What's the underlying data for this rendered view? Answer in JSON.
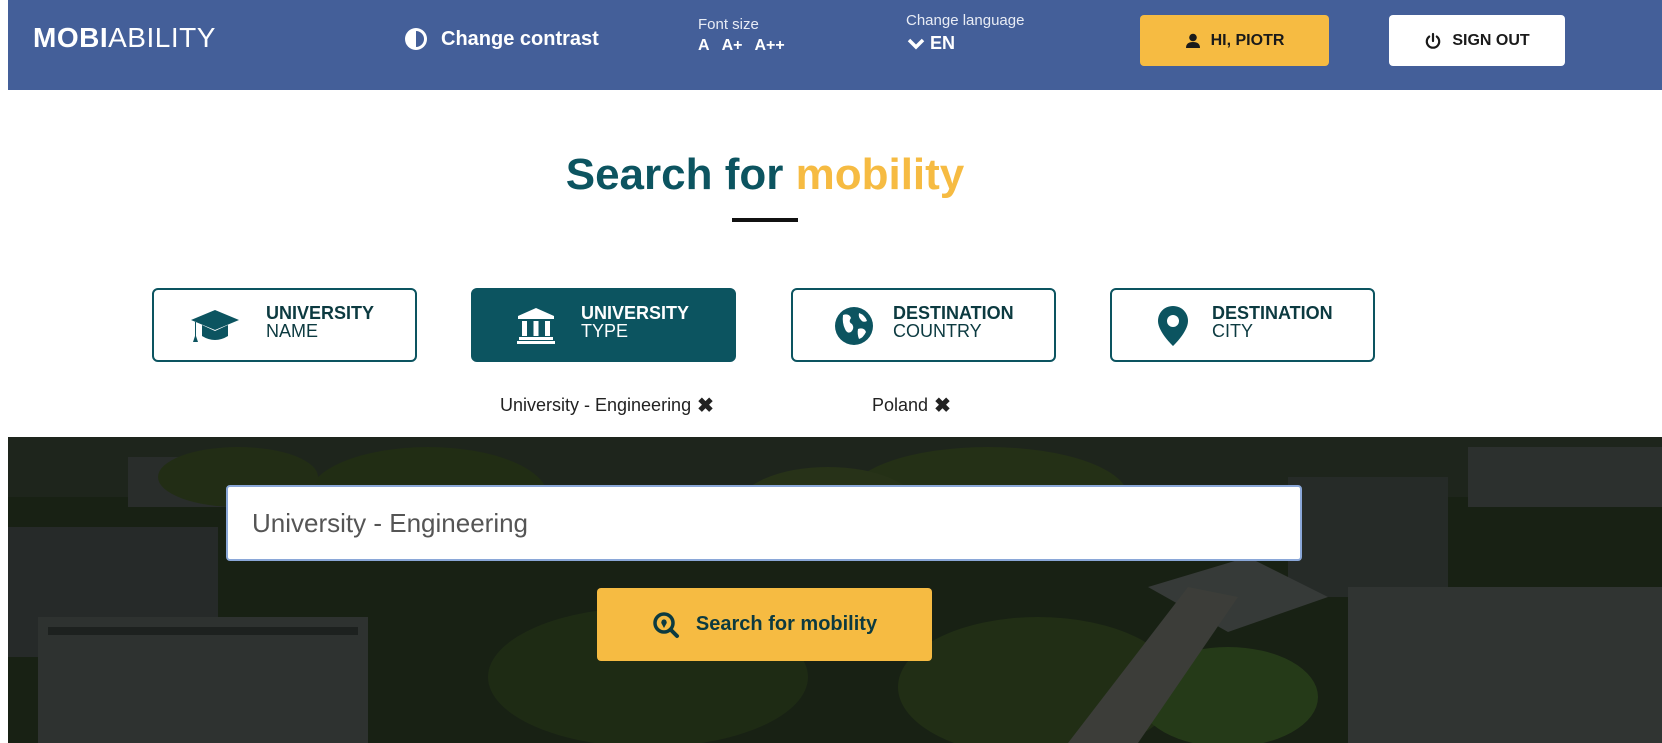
{
  "header": {
    "logo_bold": "MOBI",
    "logo_light": "ABILITY",
    "contrast_label": "Change contrast",
    "font_size_label": "Font size",
    "font_size_options": [
      "A",
      "A+",
      "A++"
    ],
    "language_label": "Change language",
    "language_value": "EN",
    "user_button": "HI, PIOTR",
    "signout_button": "SIGN OUT",
    "colors": {
      "bar": "#445f99",
      "accent": "#f6bb42"
    }
  },
  "main": {
    "title_dark": "Search for",
    "title_accent": "mobility",
    "categories": [
      {
        "line1": "UNIVERSITY",
        "line2": "NAME",
        "icon": "graduation-cap-icon",
        "active": false
      },
      {
        "line1": "UNIVERSITY",
        "line2": "TYPE",
        "icon": "institution-icon",
        "active": true
      },
      {
        "line1": "DESTINATION",
        "line2": "COUNTRY",
        "icon": "globe-icon",
        "active": false
      },
      {
        "line1": "DESTINATION",
        "line2": "CITY",
        "icon": "map-marker-icon",
        "active": false
      }
    ],
    "filters": [
      {
        "label": "University - Engineering",
        "remove": "✖"
      },
      {
        "label": "Poland",
        "remove": "✖"
      }
    ]
  },
  "search": {
    "value": "University - Engineering",
    "button_label": "Search for mobility",
    "button_icon": "search-location-icon"
  }
}
